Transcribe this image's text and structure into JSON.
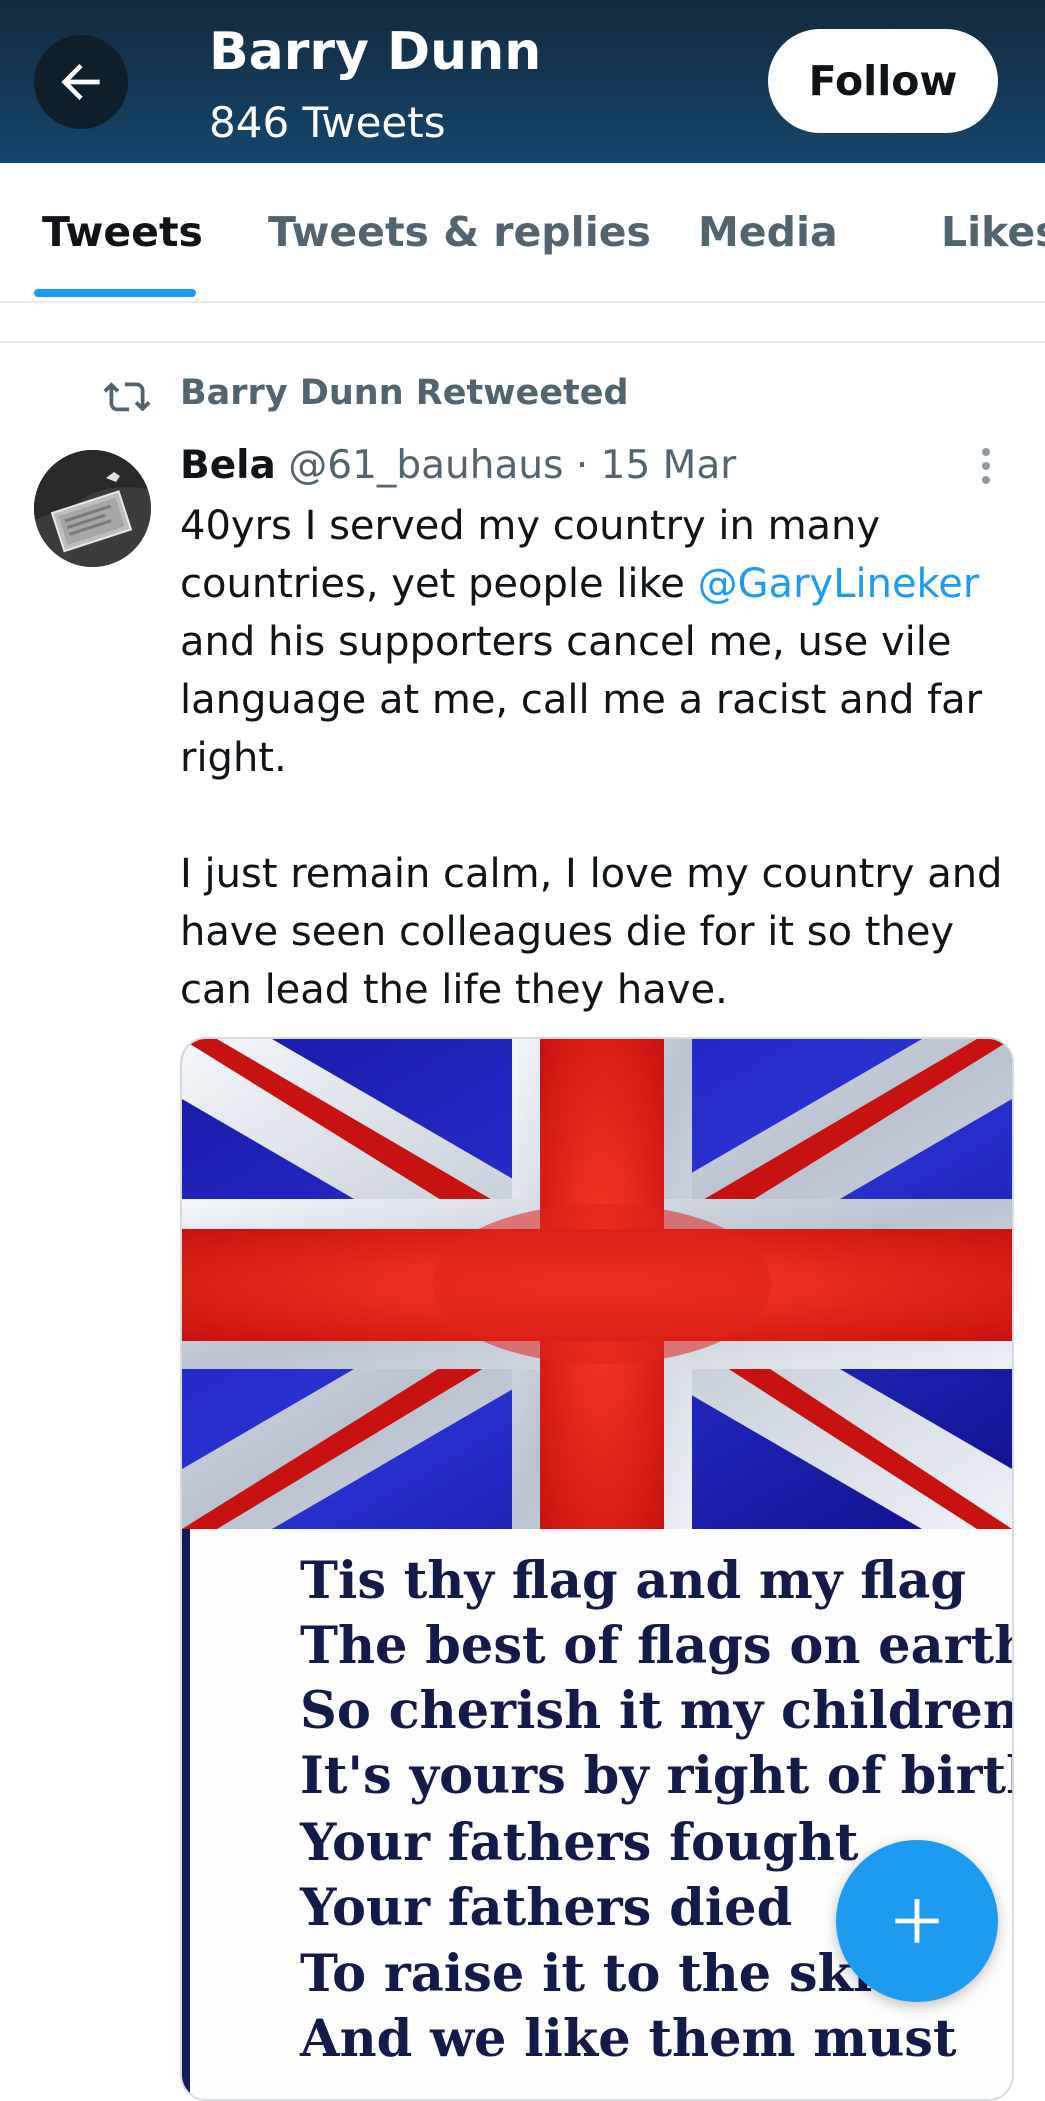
{
  "header": {
    "name": "Barry Dunn",
    "tweet_count": "846 Tweets",
    "follow_label": "Follow",
    "colors": {
      "bar_top": "#132a3e",
      "bar_bottom": "#15466d"
    }
  },
  "tabs": [
    {
      "label": "Tweets",
      "active": true
    },
    {
      "label": "Tweets & replies",
      "active": false
    },
    {
      "label": "Media",
      "active": false
    },
    {
      "label": "Likes",
      "active": false
    }
  ],
  "retweet": {
    "icon": "retweet-icon",
    "label": "Barry Dunn Retweeted"
  },
  "tweet": {
    "author": "Bela",
    "handle": "@61_bauhaus",
    "separator": "·",
    "date": "15 Mar",
    "body": {
      "line1_pre": "40yrs I served my country in many countries, yet people like ",
      "mention": "@GaryLineker",
      "line1_post": " and his supporters cancel me, use vile language at me, call me a racist and far right.",
      "paragraph2": "I just remain calm, I love my country and have seen colleagues die for it so they can lead the life they have."
    },
    "media": {
      "poem_lines": [
        "Tis thy flag and my flag",
        "The best of flags on earth",
        "So cherish it my children",
        "It's yours by right of birth",
        "Your fathers fought",
        "Your fathers died",
        "To raise it to the skies",
        "And we like them must"
      ]
    }
  },
  "accent_color": "#1d9bf0",
  "fab": {
    "icon": "plus-icon"
  }
}
